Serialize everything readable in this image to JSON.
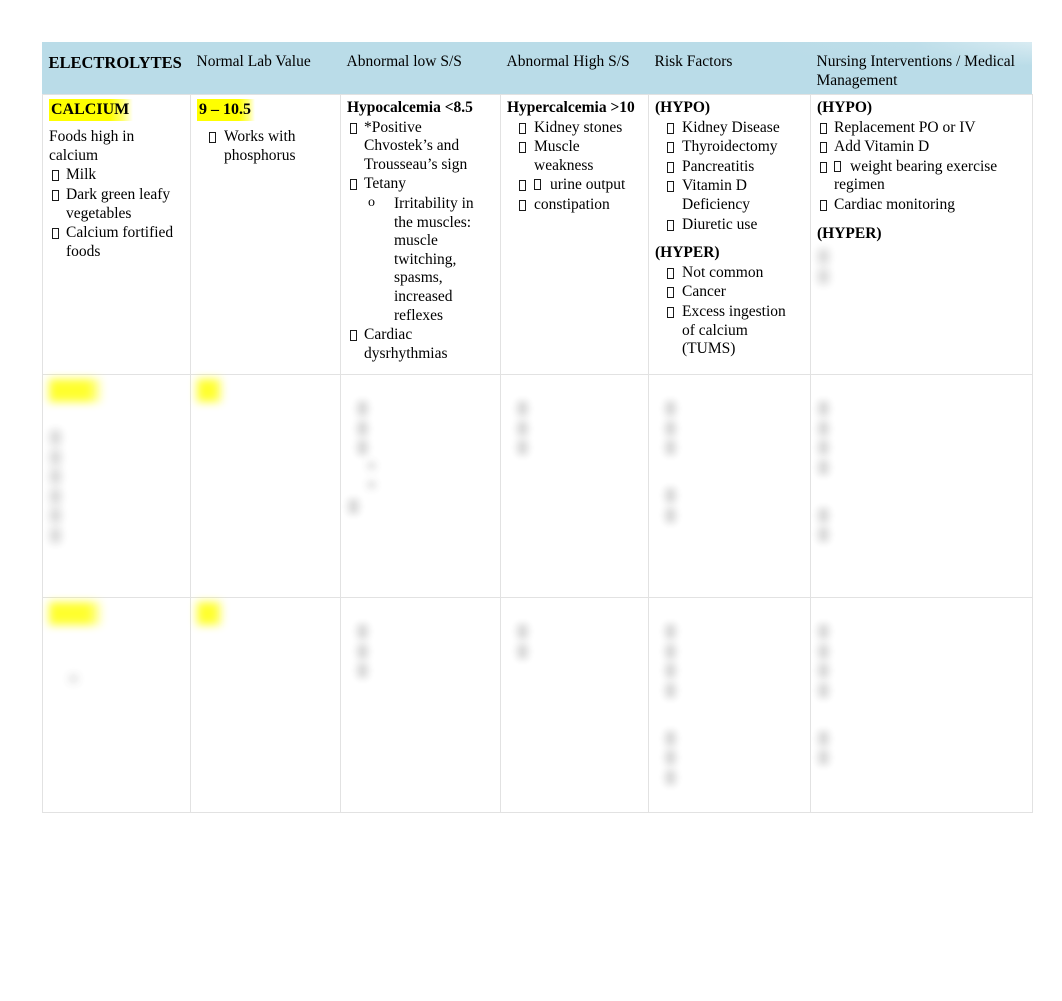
{
  "document": {
    "type": "study-chart-table",
    "colors": {
      "header_band": "#badce8",
      "highlight": "#ffff00",
      "grid_line": "#e2e2e2",
      "text": "#000000"
    }
  },
  "table": {
    "headers": [
      "ELECTROLYTES",
      "Normal Lab Value",
      "Abnormal low S/S",
      "Abnormal High S/S",
      "Risk Factors",
      "Nursing Interventions / Medical Management"
    ],
    "rows": [
      {
        "legible": true,
        "electrolyte": {
          "name": "CALCIUM",
          "intro": "Foods high in calcium",
          "bullets": [
            "Milk",
            "Dark green leafy vegetables",
            "Calcium fortified foods"
          ]
        },
        "normal_value": {
          "value": "9 – 10.5",
          "bullets": [
            "Works with phosphorus"
          ]
        },
        "abnormal_low": {
          "heading": "Hypocalcemia <8.5",
          "bullets": [
            "*Positive Chvostek’s and Trousseau’s sign",
            "Tetany",
            "Cardiac dysrhythmias"
          ],
          "sub_bullet_after": 2,
          "sub_bullets": [
            "Irritability in the muscles: muscle twitching, spasms, increased reflexes"
          ]
        },
        "abnormal_high": {
          "heading": "Hypercalcemia >10",
          "bullets": [
            "Kidney stones",
            "Muscle weakness",
            "urine output",
            "constipation"
          ],
          "arrow_bullet_index": 2
        },
        "risk_factors": {
          "hypo_label": "(HYPO)",
          "hypo": [
            "Kidney Disease",
            "Thyroidectomy",
            "Pancreatitis",
            "Vitamin D Deficiency",
            "Diuretic use"
          ],
          "hyper_label": "(HYPER)",
          "hyper": [
            "Not common",
            "Cancer",
            "Excess ingestion of calcium (TUMS)"
          ]
        },
        "interventions": {
          "hypo_label": "(HYPO)",
          "hypo": [
            "Replacement PO or IV",
            "Add Vitamin D",
            "weight bearing exercise regimen",
            "Cardiac monitoring"
          ],
          "arrow_bullet_index": 2,
          "hyper_label": "(HYPER)",
          "hyper": []
        }
      },
      {
        "legible": false,
        "note": "row content blurred / illegible in source image",
        "electrolyte": {
          "name": "",
          "intro": "",
          "bullets": [
            "",
            "",
            "",
            "",
            "",
            ""
          ]
        },
        "normal_value": {
          "value": "",
          "bullets": []
        },
        "abnormal_low": {
          "heading": "",
          "bullets": [
            "",
            "",
            "",
            ""
          ],
          "sub_bullets": [
            ""
          ]
        },
        "abnormal_high": {
          "heading": "",
          "bullets": [
            "",
            "",
            ""
          ]
        },
        "risk_factors": {
          "hypo_label": "",
          "hypo": [
            "",
            "",
            ""
          ],
          "hyper_label": "",
          "hyper": [
            "",
            ""
          ]
        },
        "interventions": {
          "hypo_label": "",
          "hypo": [
            "",
            "",
            "",
            ""
          ],
          "hyper_label": "",
          "hyper": [
            "",
            ""
          ]
        }
      },
      {
        "legible": false,
        "note": "row content blurred / illegible in source image",
        "electrolyte": {
          "name": "",
          "intro": "",
          "bullets": [
            "",
            ""
          ]
        },
        "normal_value": {
          "value": "",
          "bullets": []
        },
        "abnormal_low": {
          "heading": "",
          "bullets": [
            "",
            "",
            ""
          ]
        },
        "abnormal_high": {
          "heading": "",
          "bullets": [
            "",
            ""
          ]
        },
        "risk_factors": {
          "hypo_label": "",
          "hypo": [
            "",
            "",
            "",
            ""
          ],
          "hyper_label": "",
          "hyper": [
            "",
            "",
            ""
          ]
        },
        "interventions": {
          "hypo_label": "",
          "hypo": [
            "",
            "",
            "",
            ""
          ],
          "hyper_label": "",
          "hyper": [
            "",
            ""
          ]
        }
      }
    ]
  }
}
